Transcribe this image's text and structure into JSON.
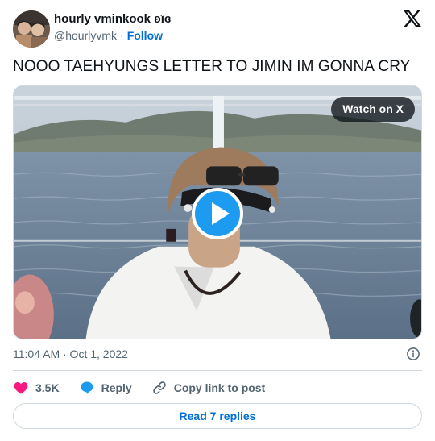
{
  "author": {
    "display_name": "hourly vminkook ʚïɞ",
    "handle": "@hourlyvmk",
    "separator": "·",
    "follow_label": "Follow"
  },
  "tweet": {
    "text": "NOOO TAEHYUNGS LETTER TO JIMIN IM GONNA CRY"
  },
  "media": {
    "watch_label": "Watch on X"
  },
  "meta": {
    "timestamp": "11:04 AM · Oct 1, 2022"
  },
  "actions": {
    "likes": "3.5K",
    "reply_label": "Reply",
    "copy_label": "Copy link to post"
  },
  "footer": {
    "read_replies_label": "Read 7 replies"
  },
  "colors": {
    "link": "#006fd6",
    "like": "#f91880",
    "reply": "#1d9bf0",
    "play": "#1d9bf0"
  },
  "icons": [
    "x-logo-icon",
    "play-icon",
    "info-icon",
    "heart-icon",
    "reply-bubble-icon",
    "link-icon"
  ]
}
